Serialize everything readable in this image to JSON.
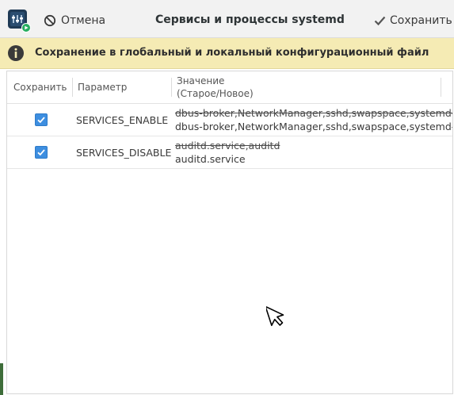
{
  "header": {
    "title": "Сервисы и процессы systemd",
    "cancel_label": "Отмена",
    "save_label": "Сохранить"
  },
  "infobar": {
    "message": "Сохранение в глобальный и локальный конфигурационный файл"
  },
  "table": {
    "columns": {
      "save": "Сохранить",
      "parameter": "Параметр",
      "value_line1": "Значение",
      "value_line2": "(Старое/Новое)"
    },
    "rows": [
      {
        "checked": true,
        "parameter": "SERVICES_ENABLE",
        "old_value": "dbus-broker,NetworkManager,sshd,swapspace,systemd-t",
        "new_value": "dbus-broker,NetworkManager,sshd,swapspace,systemd-t"
      },
      {
        "checked": true,
        "parameter": "SERVICES_DISABLE",
        "old_value": "auditd.service,auditd",
        "new_value": "auditd.service"
      }
    ]
  },
  "colors": {
    "accent": "#3d8ee0",
    "infobar_bg": "#f5ebb4",
    "header_bg": "#f2f2f2"
  },
  "icons": [
    "app-icon",
    "cancel-icon",
    "checkmark-icon",
    "info-icon",
    "mouse-cursor-icon"
  ]
}
